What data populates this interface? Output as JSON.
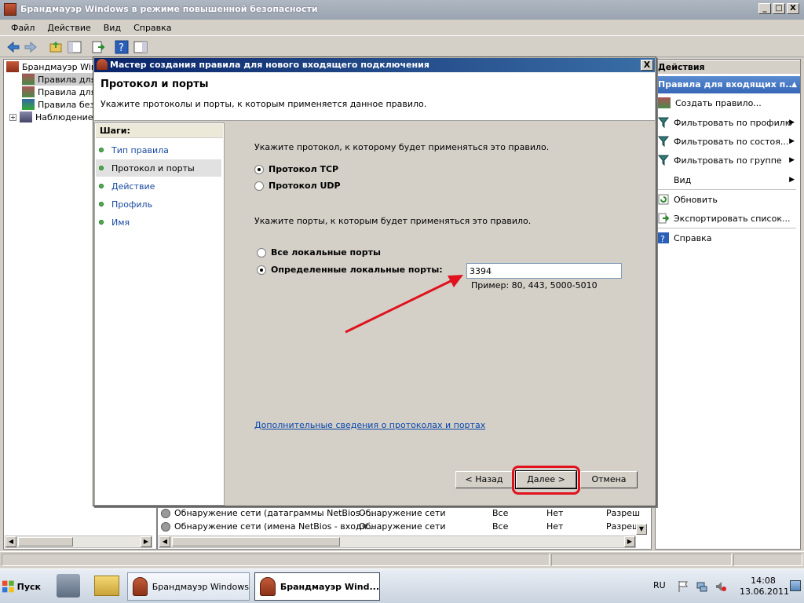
{
  "window": {
    "title": "Брандмауэр Windows в режиме повышенной безопасности",
    "buttons": [
      "_",
      "□",
      "X"
    ]
  },
  "menubar": [
    "Файл",
    "Действие",
    "Вид",
    "Справка"
  ],
  "tree": [
    {
      "label": "Брандмауэр Windo"
    },
    {
      "label": "Правила для"
    },
    {
      "label": "Правила для"
    },
    {
      "label": "Правила безо"
    },
    {
      "label": "Наблюдение"
    }
  ],
  "tree_expand": "+",
  "list_rows": [
    {
      "name": "Обнаружение сети (датаграммы NetBios - ...",
      "group": "Обнаружение сети",
      "profile": "Все",
      "enabled": "Нет",
      "action": "Разреш"
    },
    {
      "name": "Обнаружение сети (имена NetBios - входя...",
      "group": "Обнаружение сети",
      "profile": "Все",
      "enabled": "Нет",
      "action": "Разреш"
    }
  ],
  "actions": {
    "header": "Действия",
    "subheader": "Правила для входящих п...",
    "items": [
      {
        "label": "Создать правило...",
        "icon": "new-rule-icon",
        "submenu": false
      },
      {
        "label": "Фильтровать по профилю",
        "icon": "filter-icon",
        "submenu": true
      },
      {
        "label": "Фильтровать по состоя...",
        "icon": "filter-icon",
        "submenu": true
      },
      {
        "label": "Фильтровать по группе",
        "icon": "filter-icon",
        "submenu": true
      },
      {
        "label": "Вид",
        "icon": "",
        "submenu": true
      },
      {
        "label": "Обновить",
        "icon": "refresh-icon",
        "submenu": false
      },
      {
        "label": "Экспортировать список...",
        "icon": "export-icon",
        "submenu": false
      },
      {
        "label": "Справка",
        "icon": "help-icon",
        "submenu": false
      }
    ]
  },
  "dialog": {
    "title": "Мастер создания правила для нового входящего подключения",
    "close": "X",
    "heading": "Протокол и порты",
    "subheading": "Укажите протоколы и порты, к которым применяется данное правило.",
    "steps_header": "Шаги:",
    "steps": [
      {
        "label": "Тип правила",
        "active": false
      },
      {
        "label": "Протокол и порты",
        "active": true
      },
      {
        "label": "Действие",
        "active": false
      },
      {
        "label": "Профиль",
        "active": false
      },
      {
        "label": "Имя",
        "active": false
      }
    ],
    "protocol_prompt": "Укажите протокол, к которому будет применяться это правило.",
    "protocol_tcp": "Протокол TCP",
    "protocol_udp": "Протокол UDP",
    "protocol_selected": "TCP",
    "ports_prompt": "Укажите порты, к которым будет применяться это правило.",
    "ports_all": "Все локальные порты",
    "ports_specific": "Определенные локальные порты:",
    "ports_selected": "specific",
    "ports_value": "3394",
    "ports_example": "Пример: 80, 443, 5000-5010",
    "more_info_link": "Дополнительные сведения о протоколах и портах",
    "back_button": "< Назад",
    "next_button": "Далее >",
    "cancel_button": "Отмена"
  },
  "annotation": {
    "arrow_color": "#e0121e",
    "ring_color": "#e0121e"
  },
  "taskbar": {
    "start_label": "Пуск",
    "tasks": [
      "Брандмауэр Windows",
      "Брандмауэр Wind..."
    ],
    "language": "RU",
    "time": "14:08",
    "date": "13.06.2011"
  }
}
